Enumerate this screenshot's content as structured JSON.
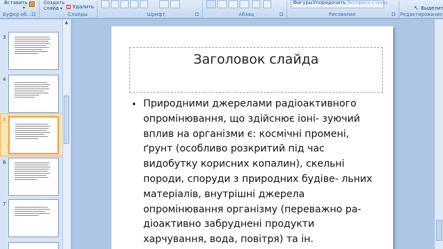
{
  "ribbon": {
    "paste_label": "Вставить",
    "create_slide_label": "Создать",
    "create_slide_label2": "слайд",
    "delete_label": "Удалить",
    "clipboard_group": "Буфер об...",
    "slides_group": "Слайды",
    "font_group": "Шрифт",
    "paragraph_group": "Абзац",
    "drawing_group": "Рисование",
    "shapes_label": "Фигуры",
    "arrange_label": "Упорядочить",
    "quick_styles_label": "Экспресс-стили",
    "select_label": "Выделить",
    "editing_group": "Редактирование"
  },
  "thumbnails": [
    {
      "number": "3",
      "selected": false
    },
    {
      "number": "4",
      "selected": false
    },
    {
      "number": "5",
      "selected": true
    },
    {
      "number": "6",
      "selected": false
    },
    {
      "number": "7",
      "selected": false
    }
  ],
  "slide": {
    "title": "Заголовок слайда",
    "bullet": "•",
    "body": "Природними джерелами радіоактивного опромінювання, що здійснює іоні- зуючий вплив на організми є: космічні промені, ґрунт (особливо розкритий під час видобутку корисних копалин), скельні породи, споруди з природних будіве- льних матеріалів, внутрішні джерела опромінювання організму (переважно ра- діоактивно забруднені продукти харчування, вода, повітря) та ін."
  }
}
